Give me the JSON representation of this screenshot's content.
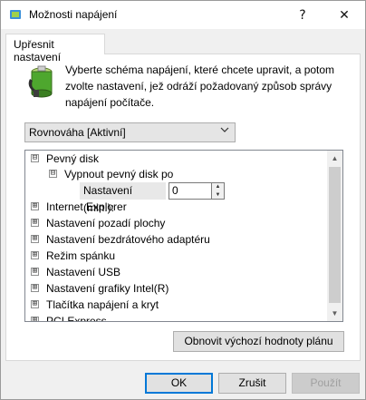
{
  "window": {
    "title": "Možnosti napájení",
    "help_glyph": "?",
    "close_glyph": "✕"
  },
  "tab": {
    "label": "Upřesnit nastavení"
  },
  "description": "Vyberte schéma napájení, které chcete upravit, a potom zvolte nastavení, jež odráží požadovaný způsob správy napájení počítače.",
  "plan_select": {
    "value": "Rovnováha [Aktivní]"
  },
  "tree": {
    "items": [
      {
        "label": "Pevný disk",
        "expander": "⊟"
      },
      {
        "label": "Vypnout pevný disk po",
        "expander": "⊟"
      },
      {
        "label": "Internet Explorer",
        "expander": "⊞"
      },
      {
        "label": "Nastavení pozadí plochy",
        "expander": "⊞"
      },
      {
        "label": "Nastavení bezdrátového adaptéru",
        "expander": "⊞"
      },
      {
        "label": "Režim spánku",
        "expander": "⊞"
      },
      {
        "label": "Nastavení USB",
        "expander": "⊞"
      },
      {
        "label": "Nastavení grafiky Intel(R)",
        "expander": "⊞"
      },
      {
        "label": "Tlačítka napájení a kryt",
        "expander": "⊞"
      },
      {
        "label": "PCI Express",
        "expander": "⊞"
      }
    ],
    "setting": {
      "label": "Nastavení (min.):",
      "value": "0"
    }
  },
  "buttons": {
    "restore": "Obnovit výchozí hodnoty plánu",
    "ok": "OK",
    "cancel": "Zrušit",
    "apply": "Použít"
  }
}
